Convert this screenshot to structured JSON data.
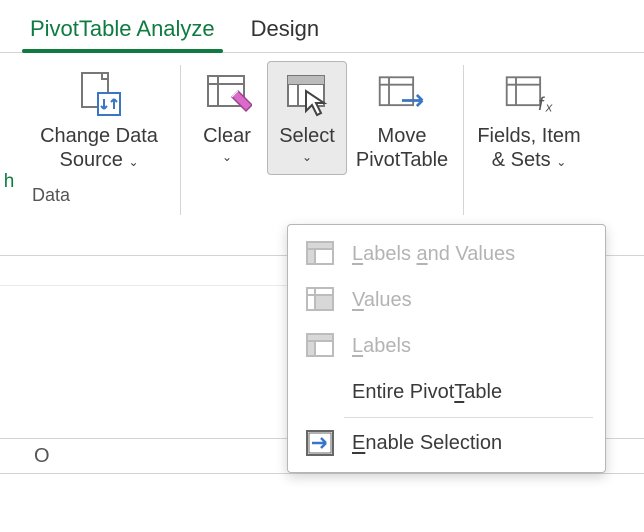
{
  "tabs": {
    "analyze": "PivotTable Analyze",
    "design": "Design"
  },
  "ribbon": {
    "edge_left": "h",
    "change_data": "Change Data\nSource",
    "clear": "Clear",
    "select": "Select",
    "move": "Move\nPivotTable",
    "fields": "Fields, Item\n& Sets",
    "group_data": "Data"
  },
  "menu": {
    "labels_values": "Labels and Values",
    "values": "Values",
    "labels": "Labels",
    "entire": "Entire PivotTable",
    "enable": "Enable Selection"
  },
  "sheet": {
    "col_o": "O"
  }
}
